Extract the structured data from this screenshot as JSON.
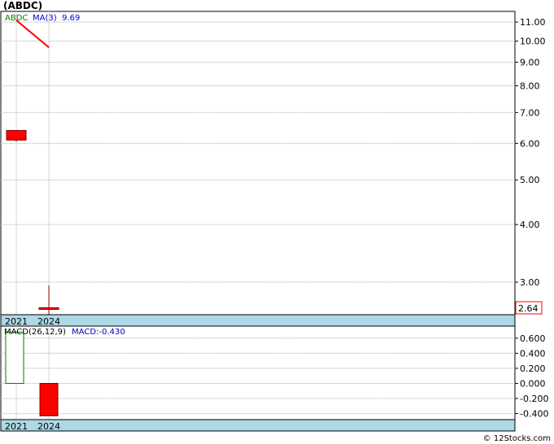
{
  "title": "(ABDC)",
  "credit": "© 12Stocks.com",
  "colors": {
    "grid": "#b0b0b0",
    "axis_band": "#add8e6",
    "down": "#ff0000",
    "up_outline": "#008000",
    "ma_line": "#ff0000",
    "label_ticker": "#008000",
    "label_ma": "#0000cc"
  },
  "chart_data": [
    {
      "type": "candlestick",
      "scale": "log",
      "legend": {
        "ticker": "ABDC",
        "ma_label": "MA(3)",
        "ma_value": "9.69"
      },
      "categories": [
        "2021",
        "2024"
      ],
      "ylim": [
        2.55,
        11.6
      ],
      "y_ticks": [
        11.0,
        10.0,
        9.0,
        8.0,
        7.0,
        6.0,
        5.0,
        4.0,
        3.0
      ],
      "y_tick_labels": [
        "11.00",
        "10.00",
        "9.00",
        "8.00",
        "7.00",
        "6.00",
        "5.00",
        "4.00",
        "3.00"
      ],
      "candles": [
        {
          "x": "2021",
          "open": 6.4,
          "close": 6.1,
          "high": 6.4,
          "low": 6.05
        },
        {
          "x": "2024",
          "open": 2.64,
          "close": 2.64,
          "high": 2.95,
          "low": 2.55
        }
      ],
      "ma_series": {
        "name": "MA(3)",
        "points": [
          {
            "x": "2021",
            "y": 11.1
          },
          {
            "x": "2024",
            "y": 9.69
          }
        ]
      },
      "last_price": "2.64"
    },
    {
      "type": "bar",
      "legend": {
        "name": "MACD(26,12,9)",
        "value_label": "MACD:-0.430"
      },
      "categories": [
        "2021",
        "2024"
      ],
      "values": [
        0.68,
        -0.43
      ],
      "ylim": [
        -0.48,
        0.76
      ],
      "y_ticks": [
        0.6,
        0.4,
        0.2,
        0.0,
        -0.2,
        -0.4
      ],
      "y_tick_labels": [
        "0.600",
        "0.400",
        "0.200",
        "0.000",
        "-0.200",
        "-0.400"
      ]
    }
  ]
}
